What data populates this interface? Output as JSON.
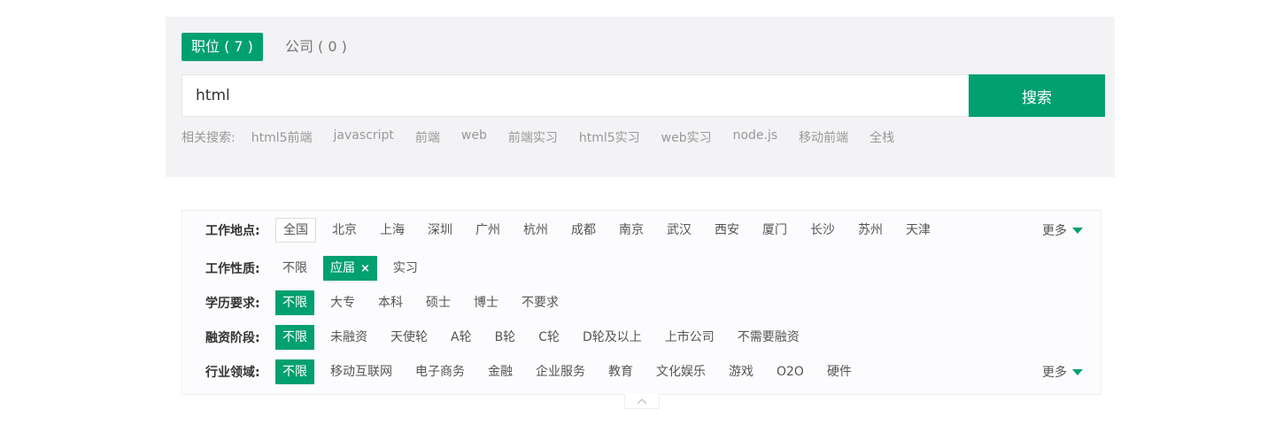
{
  "tabs": [
    {
      "label": "职位 ( 7 )",
      "active": true
    },
    {
      "label": "公司 ( 0 )",
      "active": false
    }
  ],
  "search": {
    "value": "html",
    "button_label": "搜索"
  },
  "related": {
    "label": "相关搜索:",
    "links": [
      "html5前端",
      "javascript",
      "前端",
      "web",
      "前端实习",
      "html5实习",
      "web实习",
      "node.js",
      "移动前端",
      "全栈"
    ]
  },
  "filters": {
    "location": {
      "label": "工作地点:",
      "options": [
        "全国",
        "北京",
        "上海",
        "深圳",
        "广州",
        "杭州",
        "成都",
        "南京",
        "武汉",
        "西安",
        "厦门",
        "长沙",
        "苏州",
        "天津"
      ],
      "more": "更多"
    },
    "nature": {
      "label": "工作性质:",
      "options": [
        "不限",
        "应届",
        "实习"
      ],
      "remove": "×"
    },
    "education": {
      "label": "学历要求:",
      "options": [
        "不限",
        "大专",
        "本科",
        "硕士",
        "博士",
        "不要求"
      ]
    },
    "funding": {
      "label": "融资阶段:",
      "options": [
        "不限",
        "未融资",
        "天使轮",
        "A轮",
        "B轮",
        "C轮",
        "D轮及以上",
        "上市公司",
        "不需要融资"
      ]
    },
    "industry": {
      "label": "行业领域:",
      "options": [
        "不限",
        "移动互联网",
        "电子商务",
        "金融",
        "企业服务",
        "教育",
        "文化娱乐",
        "游戏",
        "O2O",
        "硬件"
      ],
      "more": "更多"
    }
  },
  "colors": {
    "accent": "#00a06f"
  },
  "icons": {
    "more": "triangle-down-icon",
    "collapse": "chevron-up-icon"
  }
}
